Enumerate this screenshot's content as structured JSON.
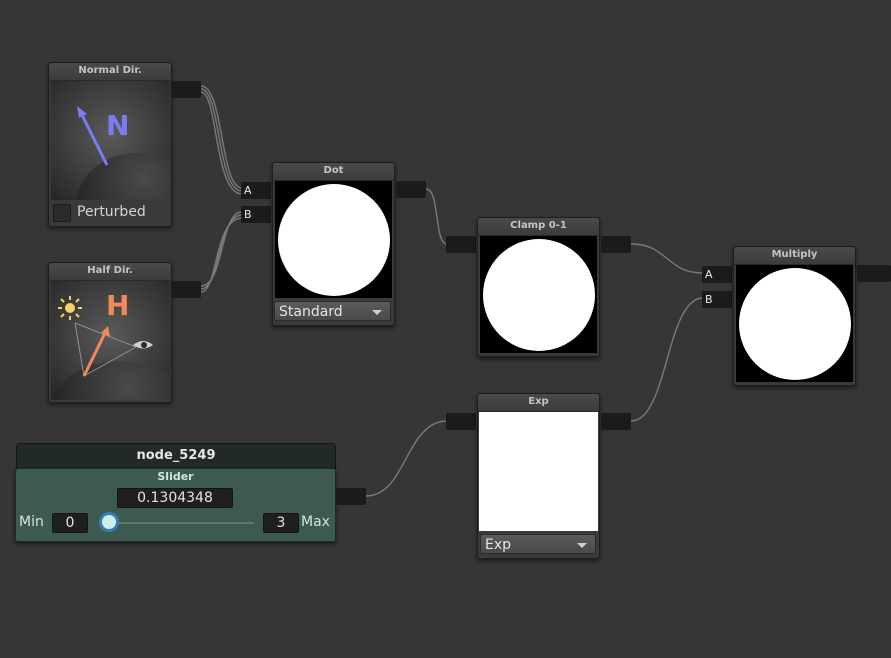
{
  "nodes": {
    "normal_dir": {
      "title": "Normal Dir.",
      "letter": "N",
      "checkbox_label": "Perturbed",
      "checkbox_checked": false
    },
    "half_dir": {
      "title": "Half Dir.",
      "letter": "H"
    },
    "dot": {
      "title": "Dot",
      "port_a": "A",
      "port_b": "B",
      "mode": "Standard"
    },
    "clamp": {
      "title": "Clamp 0-1"
    },
    "multiply": {
      "title": "Multiply",
      "port_a": "A",
      "port_b": "B"
    },
    "exp": {
      "title": "Exp",
      "mode": "Exp"
    },
    "slider": {
      "name": "node_5249",
      "title": "Slider",
      "value": "0.1304348",
      "value_fraction": 0.0435,
      "min_label": "Min",
      "min": "0",
      "max": "3",
      "max_label": "Max"
    }
  },
  "colors": {
    "canvas_bg": "#363636",
    "normal_arrow": "#7c7cf2",
    "half_arrow": "#f08a5a",
    "slider_body": "#3d5a50",
    "slider_knob": "#cfeee4",
    "wire": "#7a7a7a"
  },
  "icons": [
    "sun-icon",
    "eye-icon",
    "dropdown-arrow-icon",
    "checkbox-icon"
  ]
}
